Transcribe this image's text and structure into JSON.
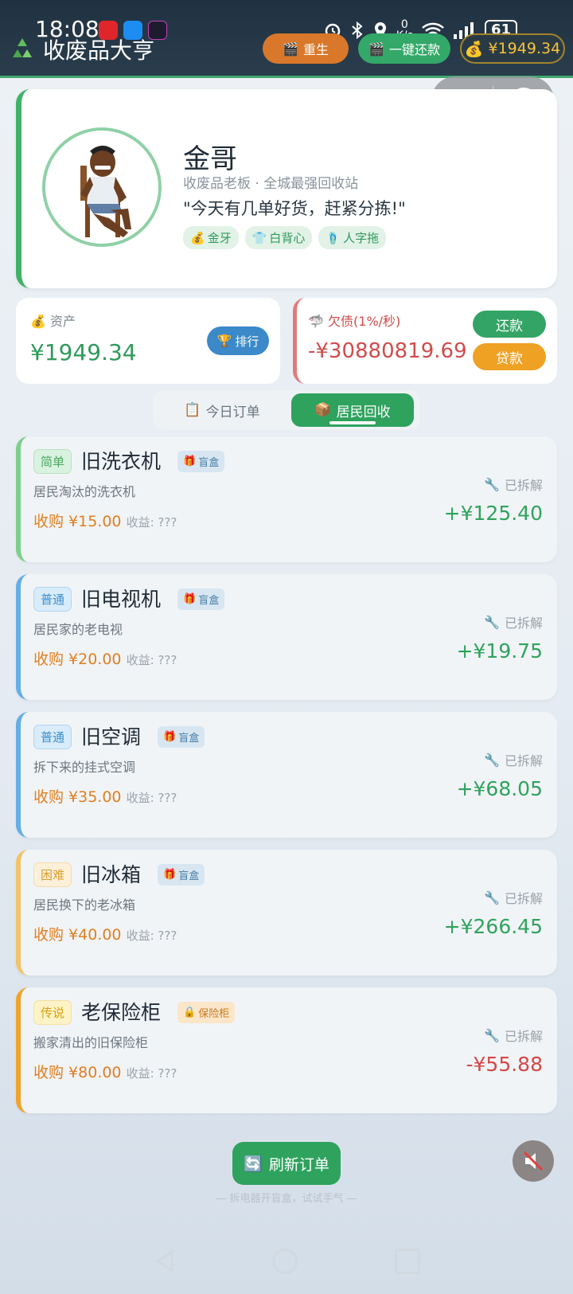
{
  "status_bar": {
    "time": "18:08",
    "net_speed": "0\nK/s",
    "battery": "61"
  },
  "header": {
    "title": "收废品大亨",
    "rebirth_label": "重生",
    "repay_all_label": "一键还款",
    "money": "¥1949.34"
  },
  "profile": {
    "name": "金哥",
    "subtitle": "收废品老板 · 全城最强回收站",
    "quote": "\"今天有几单好货，赶紧分拣!\"",
    "tags": [
      "金牙",
      "白背心",
      "人字拖"
    ]
  },
  "assets": {
    "label": "资产",
    "value": "¥1949.34",
    "rank_label": "排行"
  },
  "debt": {
    "label": "欠债(1%/秒)",
    "value": "-¥30880819.69",
    "repay_label": "还款",
    "loan_label": "贷款"
  },
  "tabs": {
    "today": "今日订单",
    "resident": "居民回收"
  },
  "items": [
    {
      "difficulty": "简单",
      "name": "旧洗衣机",
      "badge": "盲盒",
      "desc": "居民淘汰的洗衣机",
      "buy": "收购 ¥15.00",
      "gain": "收益: ???",
      "status": "已拆解",
      "profit": "+¥125.40"
    },
    {
      "difficulty": "普通",
      "name": "旧电视机",
      "badge": "盲盒",
      "desc": "居民家的老电视",
      "buy": "收购 ¥20.00",
      "gain": "收益: ???",
      "status": "已拆解",
      "profit": "+¥19.75"
    },
    {
      "difficulty": "普通",
      "name": "旧空调",
      "badge": "盲盒",
      "desc": "拆下来的挂式空调",
      "buy": "收购 ¥35.00",
      "gain": "收益: ???",
      "status": "已拆解",
      "profit": "+¥68.05"
    },
    {
      "difficulty": "困难",
      "name": "旧冰箱",
      "badge": "盲盒",
      "desc": "居民换下的老冰箱",
      "buy": "收购 ¥40.00",
      "gain": "收益: ???",
      "status": "已拆解",
      "profit": "+¥266.45"
    },
    {
      "difficulty": "传说",
      "name": "老保险柜",
      "badge": "保险柜",
      "desc": "搬家清出的旧保险柜",
      "buy": "收购 ¥80.00",
      "gain": "收益: ???",
      "status": "已拆解",
      "profit": "-¥55.88"
    }
  ],
  "footer": {
    "refresh_label": "刷新订单",
    "hint": "— 拆电器开盲盒，试试手气 —"
  },
  "icons": {
    "logo": "recycle-icon",
    "rebirth": "clapper-icon",
    "repay_all": "clapper-icon",
    "money": "money-bag-icon",
    "capsule_more": "more-dots-icon",
    "capsule_close": "target-icon",
    "rank": "trophy-icon",
    "debt": "shark-icon",
    "tab_today": "clipboard-icon",
    "tab_resident": "box-icon",
    "blind_box": "gift-icon",
    "safe": "lock-icon",
    "dismantled": "wrench-icon",
    "refresh": "refresh-icon",
    "mute": "speaker-muted-icon"
  },
  "colors": {
    "accent_green": "#2fa25e",
    "debt_red": "#d44747",
    "buy_orange": "#e07f1f",
    "header_bg": "#203241"
  }
}
